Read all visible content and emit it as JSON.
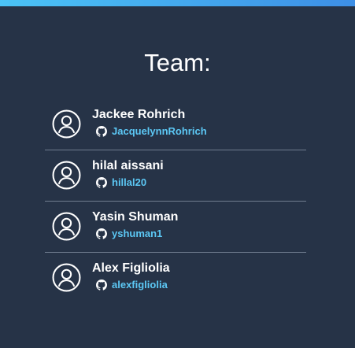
{
  "page": {
    "title": "Team:",
    "accent_color": "#4bc4f7",
    "background_color": "#263347",
    "link_color": "#5cc8f5"
  },
  "members": [
    {
      "name": "Jackee Rohrich",
      "github": "JacquelynnRohrich",
      "avatar_icon": "user-circle-icon",
      "link_icon": "github-icon"
    },
    {
      "name": "hilal aissani",
      "github": "hillal20",
      "avatar_icon": "user-circle-icon",
      "link_icon": "github-icon"
    },
    {
      "name": "Yasin Shuman",
      "github": "yshuman1",
      "avatar_icon": "user-circle-icon",
      "link_icon": "github-icon"
    },
    {
      "name": "Alex Figliolia",
      "github": "alexfigliolia",
      "avatar_icon": "user-circle-icon",
      "link_icon": "github-icon"
    }
  ]
}
